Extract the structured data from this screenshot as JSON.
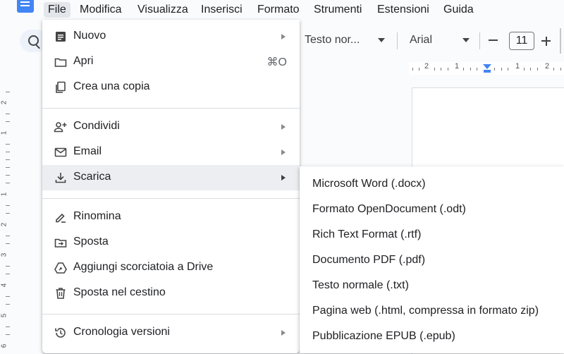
{
  "menubar": {
    "items": [
      {
        "label": "File",
        "active": true
      },
      {
        "label": "Modifica"
      },
      {
        "label": "Visualizza"
      },
      {
        "label": "Inserisci"
      },
      {
        "label": "Formato"
      },
      {
        "label": "Strumenti"
      },
      {
        "label": "Estensioni"
      },
      {
        "label": "Guida"
      }
    ]
  },
  "toolbar": {
    "style_label": "Testo nor...",
    "font_label": "Arial",
    "font_size": "11"
  },
  "ruler": {
    "h_numbers": [
      "2",
      "1",
      "1",
      "2"
    ],
    "v_numbers": [
      "2",
      "1",
      "1",
      "2",
      "3",
      "4",
      "5",
      "6"
    ]
  },
  "file_menu": {
    "items": [
      {
        "label": "Nuovo",
        "icon": "new-doc-icon",
        "submenu": true
      },
      {
        "label": "Apri",
        "icon": "folder-icon",
        "shortcut": "⌘O"
      },
      {
        "label": "Crea una copia",
        "icon": "copy-icon"
      },
      {
        "label": "Condividi",
        "icon": "person-add-icon",
        "submenu": true
      },
      {
        "label": "Email",
        "icon": "email-icon",
        "submenu": true
      },
      {
        "label": "Scarica",
        "icon": "download-icon",
        "submenu": true,
        "highlighted": true
      },
      {
        "label": "Rinomina",
        "icon": "rename-icon"
      },
      {
        "label": "Sposta",
        "icon": "move-folder-icon"
      },
      {
        "label": "Aggiungi scorciatoia a Drive",
        "icon": "drive-shortcut-icon"
      },
      {
        "label": "Sposta nel cestino",
        "icon": "trash-icon"
      },
      {
        "label": "Cronologia versioni",
        "icon": "history-icon",
        "submenu": true
      }
    ]
  },
  "download_submenu": {
    "items": [
      "Microsoft Word (.docx)",
      "Formato OpenDocument (.odt)",
      "Rich Text Format (.rtf)",
      "Documento PDF (.pdf)",
      "Testo normale (.txt)",
      "Pagina web (.html, compressa in formato zip)",
      "Pubblicazione EPUB (.epub)"
    ]
  },
  "colors": {
    "accent": "#4285f4",
    "menu_highlight": "#eceef1",
    "background": "#f9fbfd"
  }
}
